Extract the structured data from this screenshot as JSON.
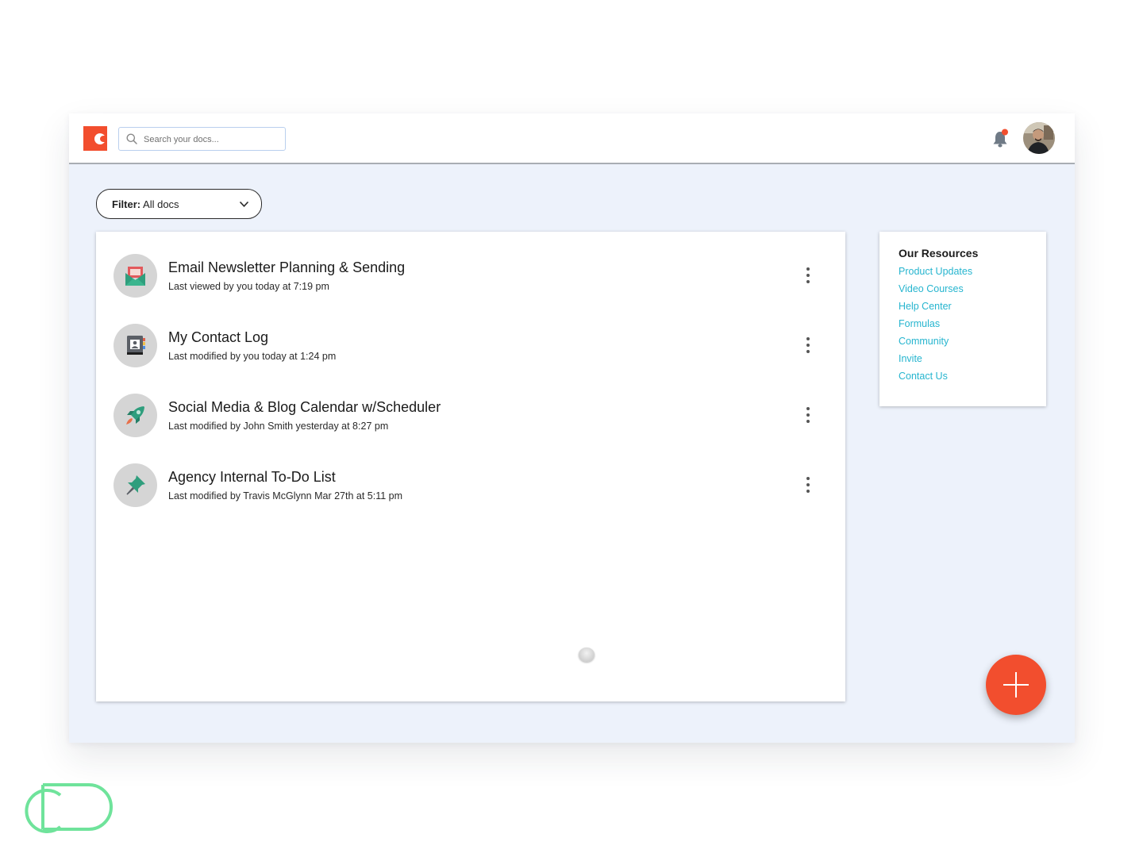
{
  "header": {
    "search_placeholder": "Search your docs...",
    "notification_dot_color": "#f24e2e",
    "logo_color": "#f24e2e"
  },
  "filter": {
    "label": "Filter:",
    "value": "All docs"
  },
  "docs": [
    {
      "title": "Email Newsletter Planning & Sending",
      "meta": "Last viewed by you today at 7:19 pm",
      "icon": "envelope-icon"
    },
    {
      "title": "My Contact Log",
      "meta": "Last modified by you today at 1:24 pm",
      "icon": "contact-book-icon"
    },
    {
      "title": "Social Media & Blog Calendar w/Scheduler",
      "meta": "Last modified by John Smith yesterday at 8:27 pm",
      "icon": "rocket-icon"
    },
    {
      "title": "Agency Internal To-Do List",
      "meta": "Last modified by Travis McGlynn Mar 27th at 5:11 pm",
      "icon": "pushpin-icon"
    }
  ],
  "resources": {
    "title": "Our Resources",
    "links": [
      "Product Updates",
      "Video Courses",
      "Help Center",
      "Formulas",
      "Community",
      "Invite",
      "Contact Us"
    ],
    "link_color": "#26b5cf"
  },
  "fab": {
    "icon": "plus-icon",
    "color": "#f24e2e"
  }
}
